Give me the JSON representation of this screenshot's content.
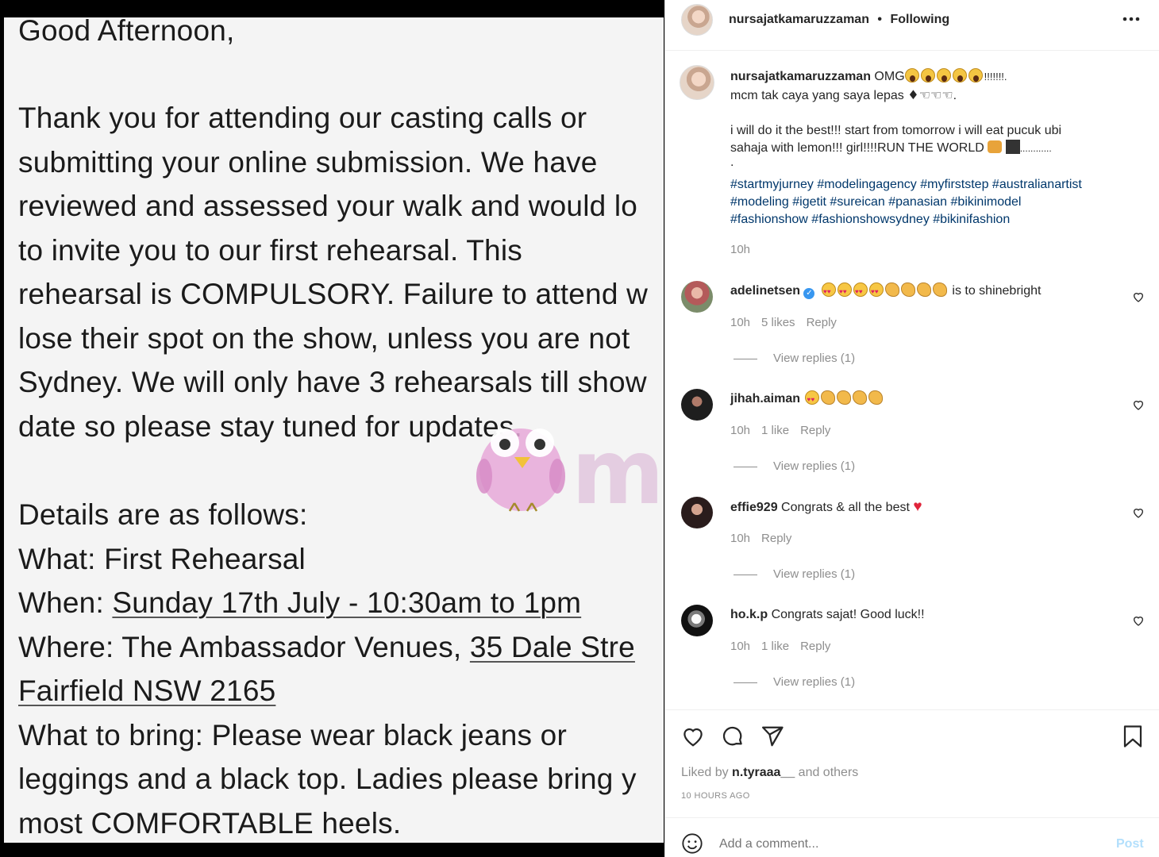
{
  "email": {
    "lines": [
      "Good Afternoon,",
      "Thank you for attending our casting calls or",
      "submitting your online submission. We have",
      "reviewed and assessed your walk and would lo",
      "to invite you to our first rehearsal. This",
      "rehearsal is COMPULSORY. Failure to attend w",
      "lose their spot on the show, unless you are not",
      "Sydney. We will only have 3 rehearsals till show",
      "date so please stay tuned for updates.",
      "Details are as follows:",
      "What: First Rehearsal"
    ],
    "when_label": "When: ",
    "when_value": "Sunday 17th July - 10:30am to 1pm",
    "where_label": "Where: The Ambassador Venues, ",
    "where_value": "35 Dale Stre",
    "where_line2": "Fairfield NSW 2165",
    "bring_lines": [
      "What to bring: Please wear black jeans or",
      "leggings and a black top. Ladies please bring y",
      "most COMFORTABLE heels."
    ]
  },
  "watermark": {
    "text": "murai"
  },
  "post": {
    "header": {
      "username": "nursajatkamaruzzaman",
      "separator": "•",
      "follow_status": "Following",
      "more_icon": "more-horizontal-icon"
    },
    "caption": {
      "username": "nursajatkamaruzzaman",
      "line1_text": "OMG",
      "line1_tail": "!!!!!!!.",
      "line2": "mcm tak caya yang saya lepas",
      "line2_tail": ".",
      "line3": "i will do it the best!!! start from tomorrow i will eat pucuk ubi",
      "line4": "sahaja with lemon!!! girl!!!!RUN THE WORLD",
      "line4_tail": "............",
      "dot": ".",
      "hashtags_line1": "#startmyjurney #modelingagency #myfirststep #australianartist",
      "hashtags_line2": "#modeling #igetit #sureican #panasian #bikinimodel",
      "hashtags_line3": "#fashionshow #fashionshowsydney #bikinifashion",
      "time": "10h"
    },
    "comments": [
      {
        "username": "adelinetsen",
        "verified": true,
        "text": "is to shinebright",
        "time": "10h",
        "likes": "5 likes",
        "reply": "Reply",
        "view_replies": "View replies (1)"
      },
      {
        "username": "jihah.aiman",
        "verified": false,
        "text": "",
        "time": "10h",
        "likes": "1 like",
        "reply": "Reply",
        "view_replies": "View replies (1)"
      },
      {
        "username": "effie929",
        "verified": false,
        "text": "Congrats & all the best",
        "time": "10h",
        "likes": "",
        "reply": "Reply",
        "view_replies": "View replies (1)"
      },
      {
        "username": "ho.k.p",
        "verified": false,
        "text": "Congrats sajat! Good luck!!",
        "time": "10h",
        "likes": "1 like",
        "reply": "Reply",
        "view_replies": "View replies (1)"
      }
    ],
    "actions": {
      "liked_by_prefix": "Liked by ",
      "liked_by_user": "n.tyraaa__",
      "liked_by_suffix": " and others",
      "timestamp": "10 HOURS AGO"
    },
    "add_comment": {
      "placeholder": "Add a comment...",
      "post_label": "Post"
    }
  },
  "colors": {
    "link_blue": "#00376b",
    "post_button_disabled": "#b2dffc",
    "muted_gray": "#8e8e8e",
    "verified_blue": "#3897f0",
    "heart_red": "#ed4956"
  }
}
